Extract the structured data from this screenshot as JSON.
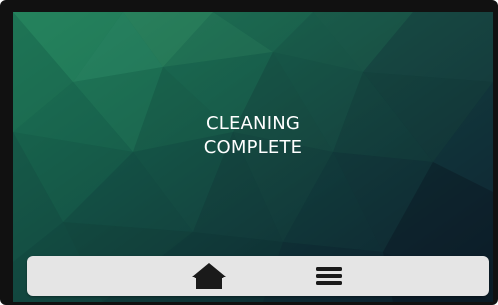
{
  "screen": {
    "message_line1": "CLEANING",
    "message_line2": "COMPLETE"
  },
  "navbar": {
    "buttons": [
      {
        "icon": "home-icon"
      },
      {
        "icon": "menu-icon"
      }
    ]
  },
  "colors": {
    "bezel": "#111111",
    "navbar_bg": "#e5e5e5",
    "icon": "#1a1a1a",
    "text": "#ffffff",
    "background_gradient": [
      "#1f7a57",
      "#133f3d",
      "#0c1a24"
    ]
  }
}
